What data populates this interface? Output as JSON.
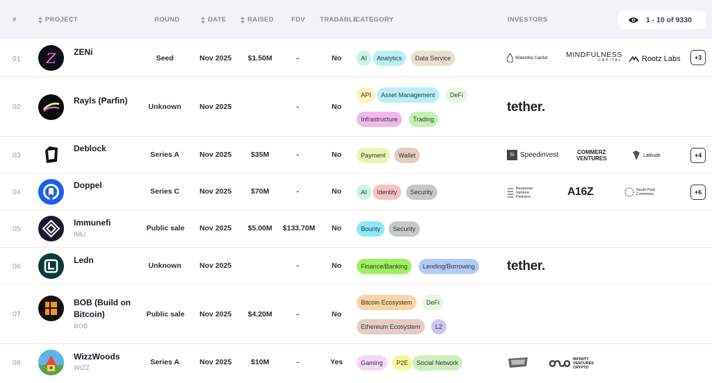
{
  "header": {
    "hash": "#",
    "project": "PROJECT",
    "round": "ROUND",
    "date": "DATE",
    "raised": "RAISED",
    "fdv": "FDV",
    "tradable": "TRADABLE",
    "category": "CATEGORY",
    "investors": "INVESTORS",
    "pager": "1 - 10 of 9330"
  },
  "rows": [
    {
      "idx": "01",
      "name": "ZENi",
      "symbol": "",
      "round": "Seed",
      "date": "Nov 2025",
      "raised": "$1.50M",
      "fdv": "-",
      "tradable": "No",
      "tags": [
        "AI",
        "Analytics",
        "Data Service"
      ],
      "investors": [
        "Waterdrip Capital",
        "MINDFULNESS",
        "CAPITAL",
        "Rootz Labs"
      ],
      "more": "+3"
    },
    {
      "idx": "02",
      "name": "Rayls (Parfin)",
      "symbol": "",
      "round": "Unknown",
      "date": "Nov 2025",
      "raised": "",
      "fdv": "-",
      "tradable": "No",
      "tags": [
        "API",
        "Asset Management",
        "DeFi",
        "Infrastructure",
        "Trading"
      ],
      "investors": [
        "tether."
      ],
      "more": ""
    },
    {
      "idx": "03",
      "name": "Deblock",
      "symbol": "",
      "round": "Series A",
      "date": "Nov 2025",
      "raised": "$35M",
      "fdv": "-",
      "tradable": "No",
      "tags": [
        "Payment",
        "Wallet"
      ],
      "investors": [
        "Speedinvest",
        "COMMERZ",
        "VENTURES",
        "Latitude"
      ],
      "more": "+4"
    },
    {
      "idx": "04",
      "name": "Doppel",
      "symbol": "",
      "round": "Series C",
      "date": "Nov 2025",
      "raised": "$70M",
      "fdv": "-",
      "tradable": "No",
      "tags": [
        "AI",
        "Identity",
        "Security"
      ],
      "investors": [
        "Bessemer",
        "Venture",
        "Partners",
        "A16Z",
        "South Park",
        "Commons"
      ],
      "more": "+6"
    },
    {
      "idx": "05",
      "name": "Immunefi",
      "symbol": "IMU",
      "round": "Public sale",
      "date": "Nov 2025",
      "raised": "$5.00M",
      "fdv": "$133.70M",
      "tradable": "No",
      "tags": [
        "Bounty",
        "Security"
      ],
      "investors": [],
      "more": ""
    },
    {
      "idx": "06",
      "name": "Ledn",
      "symbol": "",
      "round": "Unknown",
      "date": "Nov 2025",
      "raised": "",
      "fdv": "-",
      "tradable": "No",
      "tags": [
        "Finance/Banking",
        "Lending/Borrowing"
      ],
      "investors": [
        "tether."
      ],
      "more": ""
    },
    {
      "idx": "07",
      "name": "BOB (Build on Bitcoin)",
      "symbol": "BOB",
      "round": "Public sale",
      "date": "Nov 2025",
      "raised": "$4.20M",
      "fdv": "-",
      "tradable": "No",
      "tags": [
        "Bitcoin Ecosystem",
        "DeFi",
        "Ethereum Ecosystem",
        "L2"
      ],
      "investors": [],
      "more": ""
    },
    {
      "idx": "08",
      "name": "WizzWoods",
      "symbol": "WIZZ",
      "round": "Series A",
      "date": "Nov 2025",
      "raised": "$10M",
      "fdv": "-",
      "tradable": "Yes",
      "tags": [
        "Gaming",
        "P2E",
        "Social Network"
      ],
      "investors": [
        "INFINITY",
        "VENTURES",
        "CRYPTO"
      ],
      "more": ""
    }
  ],
  "colors": {
    "header_bg": "#f3f3f7",
    "tag_ai": "#c8f5e6",
    "tag_analytics": "#b9f0f5",
    "tag_data": "#eadfce"
  }
}
